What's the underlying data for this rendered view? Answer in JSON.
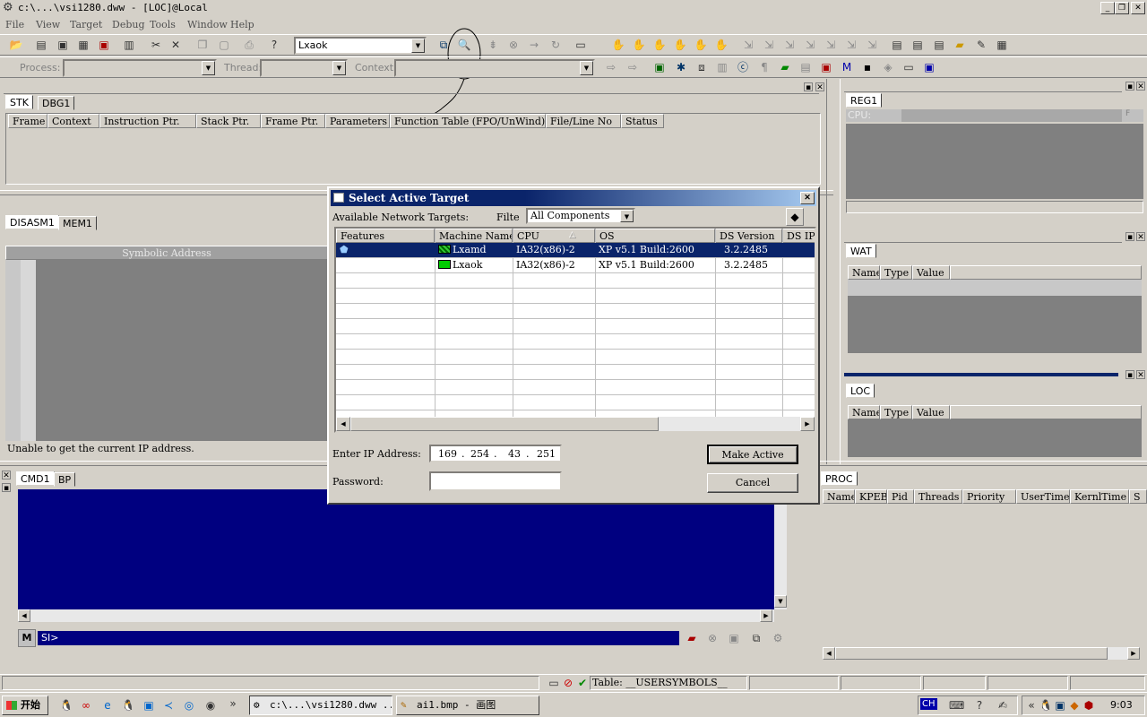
{
  "window": {
    "title": "c:\\...\\vsi1280.dww - [LOC]@Local"
  },
  "menu": [
    "File",
    "View",
    "Target",
    "Debug",
    "Tools",
    "Window",
    "Help"
  ],
  "toolbar": {
    "target_combo_value": "Lxaok",
    "process_label": "Process:",
    "thread_label": "Thread:",
    "context_label": "Context:"
  },
  "stk_panel": {
    "tabs": [
      "STK",
      "DBG1"
    ],
    "columns": [
      "Frame",
      "Context",
      "Instruction Ptr.",
      "Stack Ptr.",
      "Frame Ptr.",
      "Parameters",
      "Function Table (FPO/UnWind)",
      "File/Line No",
      "Status"
    ]
  },
  "disasm_panel": {
    "tabs": [
      "DISASM1",
      "MEM1"
    ],
    "header": "Symbolic Address",
    "status": "Unable to get the current IP address."
  },
  "cmd_panel": {
    "tabs": [
      "CMD1",
      "BP"
    ],
    "prompt": "SI>"
  },
  "reg_panel": {
    "tab": "REG1",
    "cpu_label": "CPU:",
    "f_button": "F"
  },
  "wat_panel": {
    "tab": "WAT",
    "columns": [
      "Name",
      "Type",
      "Value"
    ]
  },
  "loc_panel": {
    "tab": "LOC",
    "columns": [
      "Name",
      "Type",
      "Value"
    ]
  },
  "proc_panel": {
    "tab": "PROC",
    "columns": [
      "Name",
      "KPEB",
      "Pid",
      "Threads",
      "Priority",
      "UserTime",
      "KernlTime",
      "S"
    ]
  },
  "dialog": {
    "title": "Select Active Target",
    "available_label": "Available Network Targets:",
    "filter_label": "Filtе",
    "filter_value": "All Components",
    "columns": [
      "Features",
      "Machine Name",
      "CPU",
      "OS",
      "DS Version",
      "DS IP"
    ],
    "rows": [
      {
        "machine": "Lxamd",
        "cpu": "IA32(x86)-2",
        "os": "XP v5.1 Build:2600",
        "ds_version": "3.2.2485",
        "selected": true
      },
      {
        "machine": "Lxaok",
        "cpu": "IA32(x86)-2",
        "os": "XP v5.1 Build:2600",
        "ds_version": "3.2.2485",
        "selected": false
      }
    ],
    "ip_label": "Enter IP Address:",
    "ip": [
      "169",
      "254",
      "43",
      "251"
    ],
    "password_label": "Password:",
    "make_active": "Make Active",
    "cancel": "Cancel"
  },
  "statusbar": {
    "table_text": "Table: __USERSYMBOLS__"
  },
  "taskbar": {
    "start": "开始",
    "tasks": [
      "c:\\...\\vsi1280.dww ...",
      "ai1.bmp - 画图"
    ],
    "ime": "CH",
    "clock": "9:03"
  },
  "colors": {
    "cmd_bg": "#000080",
    "selection": "#0a246a",
    "face": "#d4d0c8",
    "panel_dark": "#808080"
  }
}
